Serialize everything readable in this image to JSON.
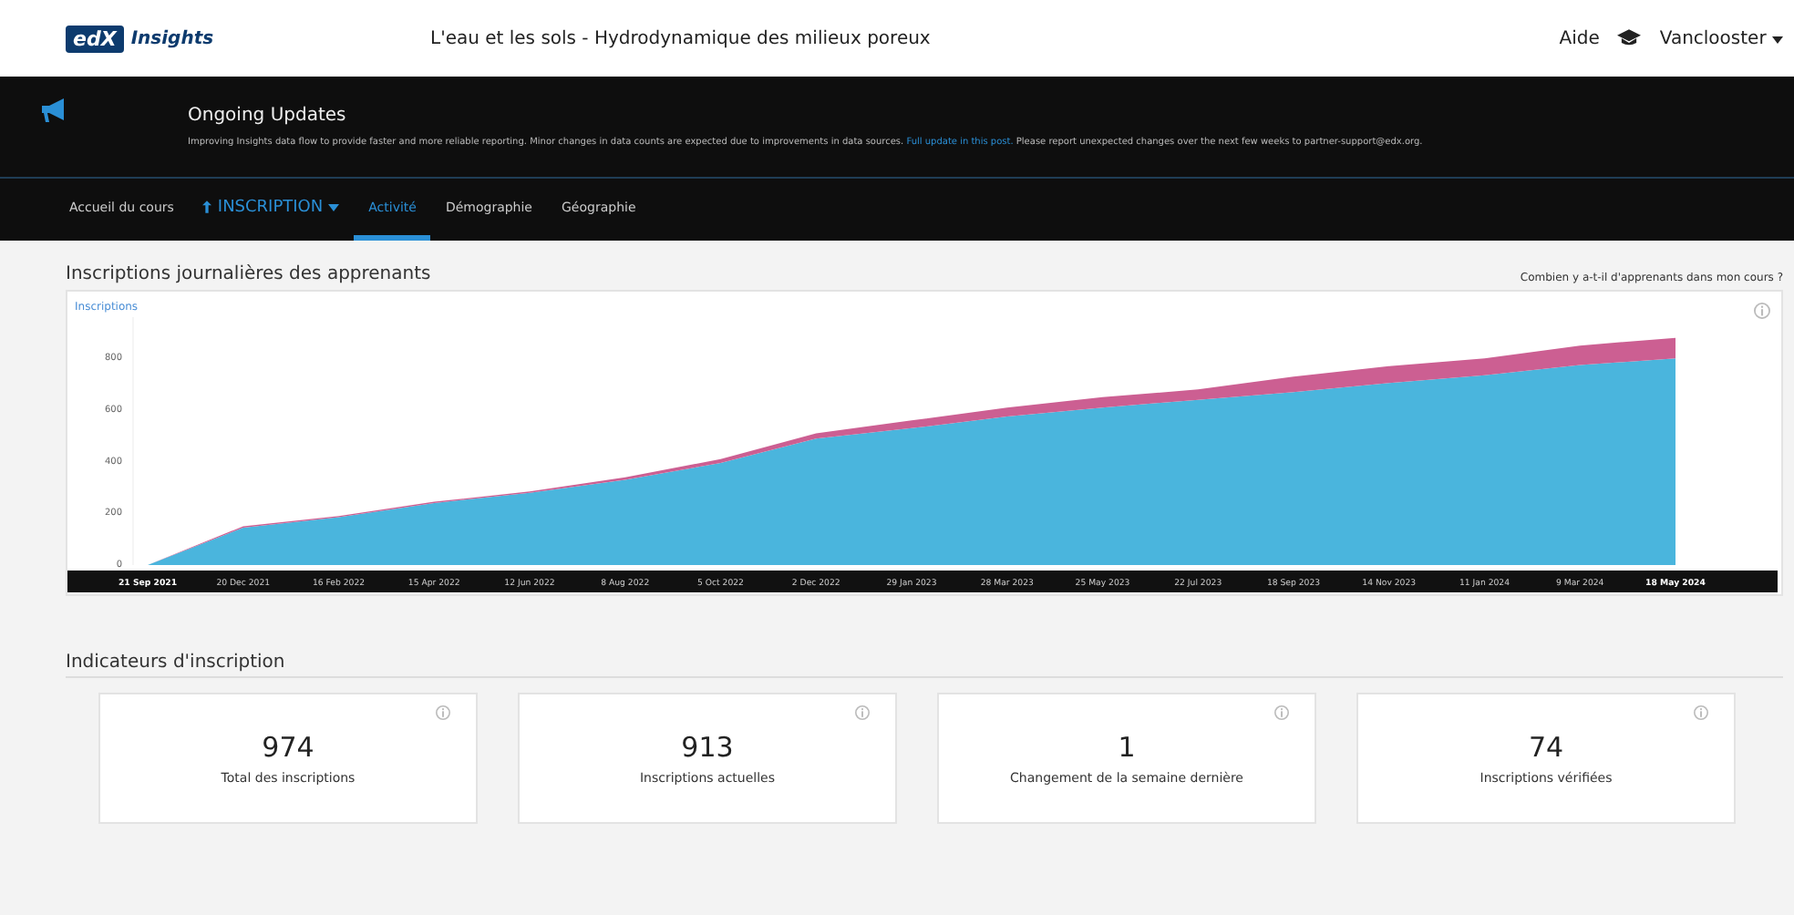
{
  "header": {
    "logo_badge": "edX",
    "logo_text": "Insights",
    "course_title": "L'eau et les sols - Hydrodynamique des milieux poreux",
    "help": "Aide",
    "user": "Vanclooster"
  },
  "banner": {
    "title": "Ongoing Updates",
    "text_before": "Improving Insights data flow to provide faster and more reliable reporting. Minor changes in data counts are expected due to improvements in data sources.",
    "link": "Full update in this post.",
    "text_after": "Please report unexpected changes over the next few weeks to partner-support@edx.org."
  },
  "nav": [
    {
      "label": "Accueil du cours",
      "kind": "link",
      "selected": false
    },
    {
      "label": "INSCRIPTION",
      "kind": "dropdown",
      "selected": false
    },
    {
      "label": "Activité",
      "kind": "link",
      "selected": true
    },
    {
      "label": "Démographie",
      "kind": "link",
      "selected": false
    },
    {
      "label": "Géographie",
      "kind": "link",
      "selected": false
    }
  ],
  "enrollment": {
    "title": "Inscriptions journalières des apprenants",
    "help_link": "Combien y a-t-il d'apprenants dans mon cours ?",
    "chart_data": {
      "type": "area",
      "ylabel": "Inscriptions",
      "stacked": true,
      "yticks": [
        0,
        200,
        400,
        600,
        800
      ],
      "ylim": [
        0,
        960
      ],
      "categories": [
        "21 Sep 2021",
        "20 Dec 2021",
        "16 Feb 2022",
        "15 Apr 2022",
        "12 Jun 2022",
        "8 Aug 2022",
        "5 Oct 2022",
        "2 Dec 2022",
        "29 Jan 2023",
        "28 Mar 2023",
        "25 May 2023",
        "22 Jul 2023",
        "18 Sep 2023",
        "14 Nov 2023",
        "11 Jan 2024",
        "9 Mar 2024",
        "18 May 2024"
      ],
      "series": [
        {
          "color": "#4ab5dd",
          "values": [
            0,
            145,
            185,
            240,
            280,
            330,
            395,
            490,
            530,
            575,
            610,
            640,
            670,
            705,
            735,
            775,
            800
          ]
        },
        {
          "color": "#cc5f92",
          "values": [
            0,
            5,
            5,
            5,
            5,
            10,
            15,
            20,
            30,
            35,
            40,
            40,
            60,
            65,
            65,
            75,
            80
          ]
        }
      ]
    }
  },
  "metrics": {
    "title": "Indicateurs d'inscription",
    "cards": [
      {
        "value": "974",
        "label": "Total des inscriptions"
      },
      {
        "value": "913",
        "label": "Inscriptions actuelles"
      },
      {
        "value": "1",
        "label": "Changement de la semaine dernière"
      },
      {
        "value": "74",
        "label": "Inscriptions vérifiées"
      }
    ]
  }
}
